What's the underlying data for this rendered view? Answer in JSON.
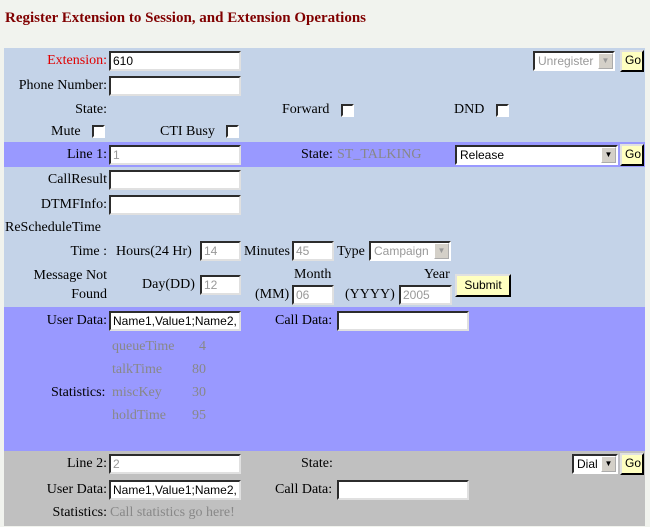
{
  "header": {
    "title": "Register Extension to Session, and Extension Operations"
  },
  "colors": {
    "title": "#800000",
    "panel_light": "#c4d3e8",
    "panel_line": "#9999ff",
    "panel_gray": "#c0c0c0",
    "extension_label": "#e00000"
  },
  "extension": {
    "label": "Extension:",
    "value": "610",
    "phone_label": "Phone Number:",
    "phone_value": "",
    "register_select": "Unregister",
    "go_label": "Go",
    "state_label": "State:",
    "forward_label": "Forward",
    "dnd_label": "DND",
    "mute_label": "Mute",
    "cti_busy_label": "CTI Busy"
  },
  "line1": {
    "label": "Line 1:",
    "value": "1",
    "state_label": "State:",
    "state_value": "ST_TALKING",
    "action_select": "Release",
    "go_label": "Go",
    "call_result_label": "CallResult",
    "call_result_value": "",
    "dtmf_label": "DTMFInfo:",
    "dtmf_value": "",
    "reschedule_label": "ReScheduleTime",
    "time_label": "Time :",
    "hours_label": "Hours(24 Hr)",
    "hours_value": "14",
    "minutes_label": "Minutes",
    "minutes_value": "45",
    "type_label": "Type",
    "type_select": "Campaign",
    "message_label_1": "Message Not",
    "message_label_2": "Found",
    "day_label": "Day(DD)",
    "day_value": "12",
    "month_label_1": "Month",
    "month_label_2": "(MM)",
    "month_value": "06",
    "year_label_1": "Year",
    "year_label_2": "(YYYY)",
    "year_value": "2005",
    "submit_label": "Submit",
    "user_data_label": "User Data:",
    "user_data_value": "Name1,Value1;Name2,",
    "call_data_label": "Call Data:",
    "call_data_value": "",
    "statistics_label": "Statistics:",
    "statistics": [
      {
        "key": "queueTime",
        "value": "4"
      },
      {
        "key": "talkTime",
        "value": "80"
      },
      {
        "key": "miscKey",
        "value": "30"
      },
      {
        "key": "holdTime",
        "value": "95"
      }
    ]
  },
  "line2": {
    "label": "Line 2:",
    "value": "2",
    "state_label": "State:",
    "action_select": "Dial",
    "go_label": "Go",
    "user_data_label": "User Data:",
    "user_data_value": "Name1,Value1;Name2,",
    "call_data_label": "Call Data:",
    "call_data_value": "",
    "statistics_label": "Statistics:",
    "statistics_value": "Call statistics go here!"
  }
}
